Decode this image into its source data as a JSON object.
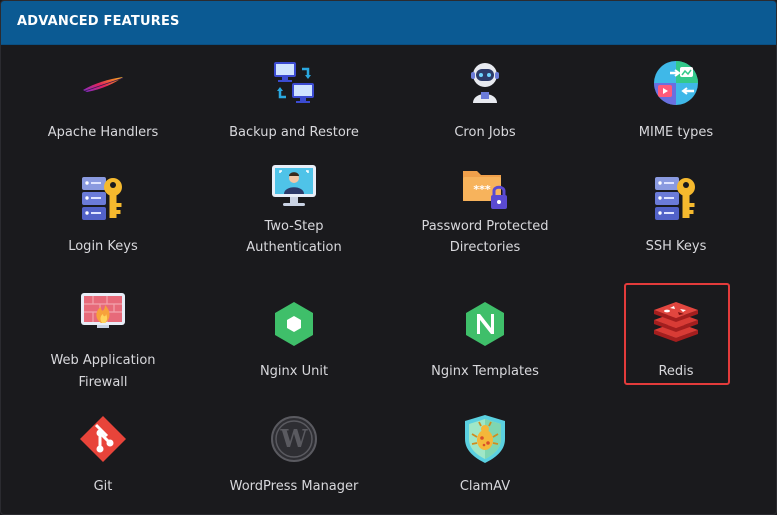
{
  "header": {
    "title": "ADVANCED FEATURES"
  },
  "features": {
    "apache_handlers": {
      "label": "Apache Handlers",
      "icon": "apache-feather-icon"
    },
    "backup_restore": {
      "label": "Backup and Restore",
      "icon": "backup-monitors-icon"
    },
    "cron_jobs": {
      "label": "Cron Jobs",
      "icon": "robot-icon"
    },
    "mime_types": {
      "label": "MIME types",
      "icon": "mime-icon"
    },
    "login_keys": {
      "label": "Login Keys",
      "icon": "server-key-icon"
    },
    "two_step": {
      "label_line1": "Two-Step",
      "label_line2": "Authentication",
      "icon": "monitor-user-icon"
    },
    "password_dirs": {
      "label_line1": "Password Protected",
      "label_line2": "Directories",
      "icon": "folder-lock-icon"
    },
    "ssh_keys": {
      "label": "SSH Keys",
      "icon": "server-key-icon"
    },
    "waf": {
      "label_line1": "Web Application",
      "label_line2": "Firewall",
      "icon": "firewall-icon"
    },
    "nginx_unit": {
      "label": "Nginx Unit",
      "icon": "hexagon-icon"
    },
    "nginx_templates": {
      "label": "Nginx Templates",
      "icon": "nginx-n-icon"
    },
    "redis": {
      "label": "Redis",
      "icon": "redis-stack-icon"
    },
    "git": {
      "label": "Git",
      "icon": "git-icon"
    },
    "wordpress": {
      "label": "WordPress Manager",
      "icon": "wordpress-icon"
    },
    "clamav": {
      "label": "ClamAV",
      "icon": "clamav-shield-icon"
    }
  },
  "colors": {
    "header_bg": "#0b5a93",
    "panel_bg": "#1a1a1d",
    "label_text": "#d8d8dc",
    "highlight_border": "#e33b3b"
  }
}
